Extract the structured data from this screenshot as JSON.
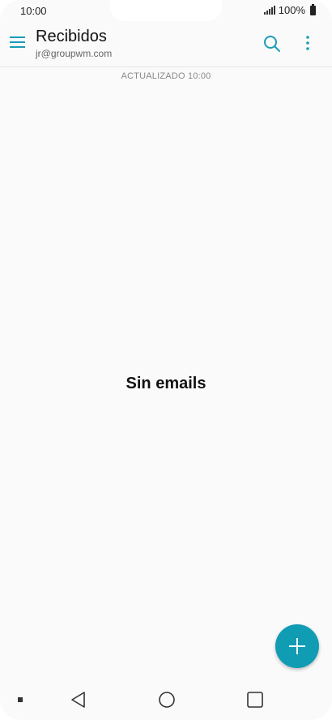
{
  "status_bar": {
    "time": "10:00",
    "battery": "100%"
  },
  "header": {
    "title": "Recibidos",
    "account": "jr@groupwm.com"
  },
  "mailbox": {
    "updated_label": "ACTUALIZADO 10:00",
    "empty_message": "Sin emails"
  },
  "colors": {
    "accent": "#1b9cb8",
    "fab": "#109cb3",
    "background": "#fafafa"
  },
  "icons": {
    "menu": "hamburger-menu-icon",
    "search": "search-icon",
    "more": "more-vertical-icon",
    "compose": "plus-icon",
    "back": "back-triangle-icon",
    "home": "home-circle-icon",
    "recent": "recent-square-icon"
  }
}
